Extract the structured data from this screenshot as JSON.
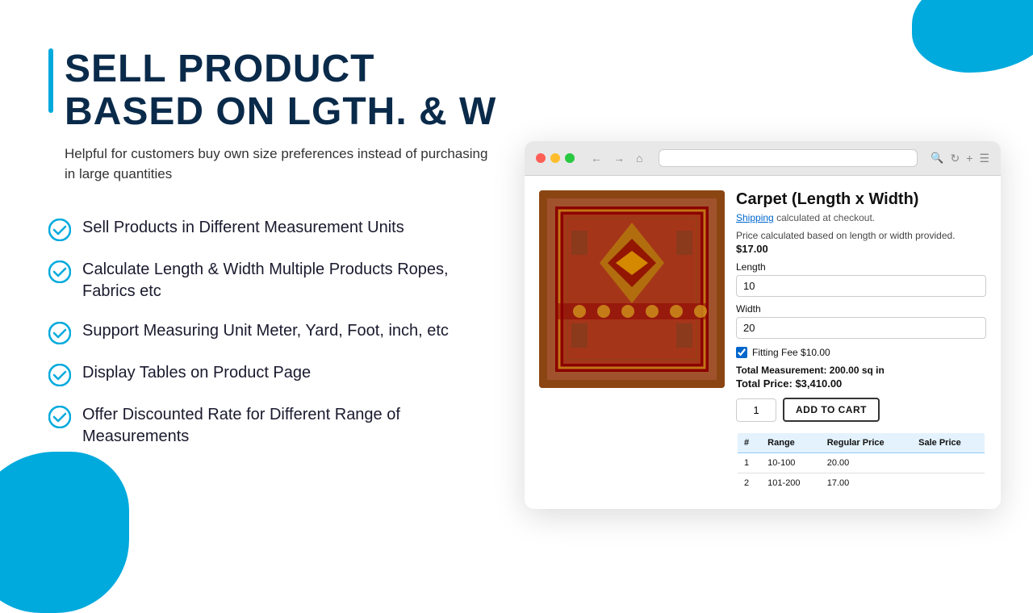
{
  "page": {
    "title": "SELL PRODUCT BASED ON LGTH. & W",
    "subtitle": "Helpful for customers buy own size preferences instead of purchasing in large quantities"
  },
  "features": [
    {
      "id": 1,
      "text": "Sell Products in Different Measurement Units"
    },
    {
      "id": 2,
      "text": "Calculate Length & Width Multiple Products Ropes, Fabrics etc"
    },
    {
      "id": 3,
      "text": "Support Measuring Unit Meter, Yard, Foot, inch, etc"
    },
    {
      "id": 4,
      "text": "Display Tables on Product Page"
    },
    {
      "id": 5,
      "text": "Offer Discounted Rate for Different Range of Measurements"
    }
  ],
  "product": {
    "title": "Carpet (Length x Width)",
    "shipping_text": "Shipping",
    "shipping_suffix": "calculated at checkout.",
    "price_desc": "Price calculated based on length or width provided.",
    "price": "$17.00",
    "length_label": "Length",
    "length_value": "10",
    "width_label": "Width",
    "width_value": "20",
    "fitting_fee_label": "Fitting Fee $10.00",
    "total_measurement": "Total Measurement: 200.00 sq in",
    "total_price": "Total Price: $3,410.00",
    "qty_value": "1",
    "add_to_cart": "ADD TO CART"
  },
  "price_table": {
    "headers": [
      "#",
      "Range",
      "Regular Price",
      "Sale Price"
    ],
    "rows": [
      {
        "num": "1",
        "range": "10-100",
        "regular": "20.00",
        "sale": ""
      },
      {
        "num": "2",
        "range": "101-200",
        "regular": "17.00",
        "sale": ""
      }
    ]
  }
}
